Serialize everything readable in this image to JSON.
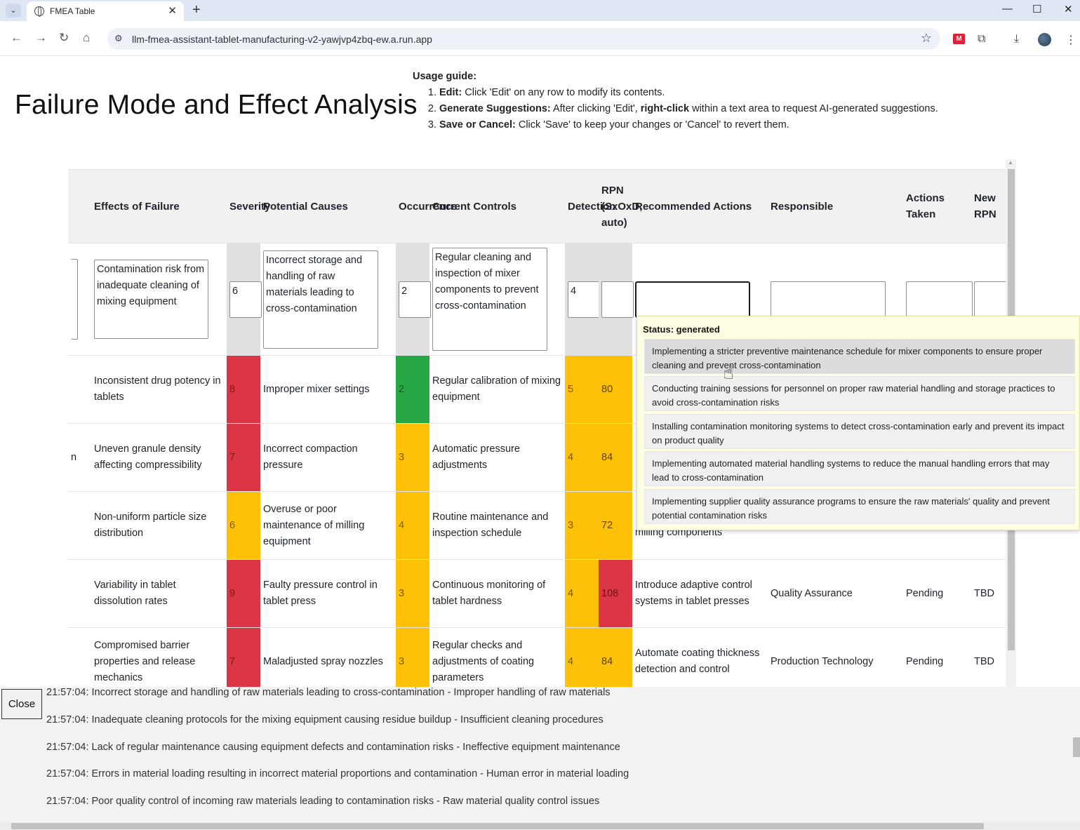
{
  "browser": {
    "tab_title": "FMEA Table",
    "url": "llm-fmea-assistant-tablet-manufacturing-v2-yawjvp4zbq-ew.a.run.app"
  },
  "page": {
    "title": "Failure Mode and Effect Analysis"
  },
  "guide": {
    "heading": "Usage guide:",
    "items": [
      {
        "label": "Edit:",
        "text": " Click 'Edit' on any row to modify its contents."
      },
      {
        "label": "Generate Suggestions:",
        "text": " After clicking 'Edit', ",
        "bold2": "right-click",
        "text2": " within a text area to request AI-generated suggestions."
      },
      {
        "label": "Save or Cancel:",
        "text": " Click 'Save' to keep your changes or 'Cancel' to revert them."
      }
    ]
  },
  "table": {
    "headers": {
      "effects": "Effects of Failure",
      "severity": "Severity",
      "causes": "Potential Causes",
      "occurrence": "Occurrence",
      "controls": "Current Controls",
      "detection": "Detection",
      "rpn": "RPN (SxOxD, auto)",
      "actions": "Recommended Actions",
      "responsible": "Responsible",
      "taken": "Actions Taken",
      "new_rpn": "New RPN"
    },
    "edit_row": {
      "effects": "Contamination risk from inadequate cleaning of mixing equipment",
      "severity": "6",
      "causes": "Incorrect storage and handling of raw materials leading to cross-contamination",
      "occurrence": "2",
      "controls": "Regular cleaning and inspection of mixer components to prevent cross-contamination",
      "detection": "4"
    },
    "rows": [
      {
        "effects": "Inconsistent drug potency in tablets",
        "severity": "8",
        "causes": "Improper mixer settings",
        "occurrence": "2",
        "controls": "Regular calibration of mixing equipment",
        "detection": "5",
        "rpn": "80",
        "actions": "",
        "responsible": "",
        "taken": "",
        "new_rpn": ""
      },
      {
        "effects": "Uneven granule density affecting compressibility",
        "severity": "7",
        "causes": "Incorrect compaction pressure",
        "occurrence": "3",
        "controls": "Automatic pressure adjustments",
        "detection": "4",
        "rpn": "84",
        "actions": "",
        "responsible": "",
        "taken": "",
        "new_rpn": ""
      },
      {
        "effects": "Non-uniform particle size distribution",
        "severity": "6",
        "causes": "Overuse or poor maintenance of milling equipment",
        "occurrence": "4",
        "controls": "Routine maintenance and inspection schedule",
        "detection": "3",
        "rpn": "72",
        "actions": "milling components",
        "responsible": "",
        "taken": "",
        "new_rpn": ""
      },
      {
        "effects": "Variability in tablet dissolution rates",
        "severity": "9",
        "causes": "Faulty pressure control in tablet press",
        "occurrence": "3",
        "controls": "Continuous monitoring of tablet hardness",
        "detection": "4",
        "rpn": "108",
        "actions": "Introduce adaptive control systems in tablet presses",
        "responsible": "Quality Assurance",
        "taken": "Pending",
        "new_rpn": "TBD"
      },
      {
        "effects": "Compromised barrier properties and release mechanics",
        "severity": "7",
        "causes": "Maladjusted spray nozzles",
        "occurrence": "3",
        "controls": "Regular checks and adjustments of coating parameters",
        "detection": "4",
        "rpn": "84",
        "actions": "Automate coating thickness detection and control",
        "responsible": "Production Technology",
        "taken": "Pending",
        "new_rpn": "TBD"
      }
    ],
    "partial_left_text": "n"
  },
  "popup": {
    "status": "Status: generated",
    "suggestions": [
      "Implementing a stricter preventive maintenance schedule for mixer components to ensure proper cleaning and prevent cross-contamination",
      "Conducting training sessions for personnel on proper raw material handling and storage practices to avoid cross-contamination risks",
      "Installing contamination monitoring systems to detect cross-contamination early and prevent its impact on product quality",
      "Implementing automated material handling systems to reduce the manual handling errors that may lead to cross-contamination",
      "Implementing supplier quality assurance programs to ensure the raw materials' quality and prevent potential contamination risks"
    ]
  },
  "log": {
    "close_label": "Close",
    "lines": [
      "21:57:04: Incorrect storage and handling of raw materials leading to cross-contamination - Improper handling of raw materials",
      "21:57:04: Inadequate cleaning protocols for the mixing equipment causing residue buildup - Insufficient cleaning procedures",
      "21:57:04: Lack of regular maintenance causing equipment defects and contamination risks - Ineffective equipment maintenance",
      "21:57:04: Errors in material loading resulting in incorrect material proportions and contamination - Human error in material loading",
      "21:57:04: Poor quality control of incoming raw materials leading to contamination risks - Raw material quality control issues"
    ]
  },
  "colors": {
    "red": "#dc3545",
    "amber": "#ffc107",
    "green": "#28a745",
    "popup_bg": "#ffffe3"
  }
}
